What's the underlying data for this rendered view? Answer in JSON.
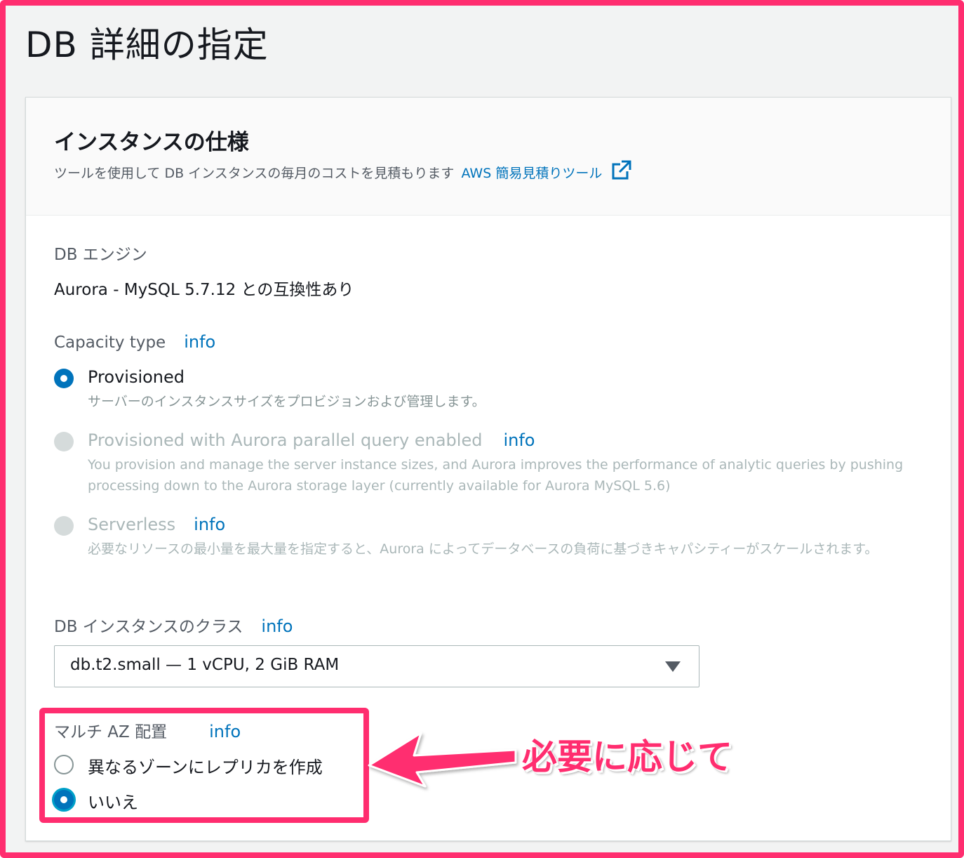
{
  "page": {
    "title": "DB 詳細の指定"
  },
  "panel": {
    "title": "インスタンスの仕様",
    "description": "ツールを使用して DB インスタンスの毎月のコストを見積もります",
    "description_link": "AWS 簡易見積りツール",
    "external_icon": "external-link-icon"
  },
  "engine": {
    "label": "DB エンジン",
    "value": "Aurora - MySQL 5.7.12 との互換性あり"
  },
  "capacity": {
    "label": "Capacity type",
    "info": "info",
    "options": [
      {
        "title": "Provisioned",
        "description": "サーバーのインスタンスサイズをプロビジョンおよび管理します。",
        "state": "selected"
      },
      {
        "title": "Provisioned with Aurora parallel query enabled",
        "info": "info",
        "description": "You provision and manage the server instance sizes, and Aurora improves the performance of analytic queries by pushing processing down to the Aurora storage layer (currently available for Aurora MySQL 5.6)",
        "state": "disabled"
      },
      {
        "title": "Serverless",
        "info": "info",
        "description": "必要なリソースの最小量を最大量を指定すると、Aurora によってデータベースの負荷に基づきキャパシティーがスケールされます。",
        "state": "disabled"
      }
    ]
  },
  "instance_class": {
    "label": "DB インスタンスのクラス",
    "info": "info",
    "selected": "db.t2.small — 1 vCPU, 2 GiB RAM"
  },
  "multi_az": {
    "label": "マルチ AZ 配置",
    "info": "info",
    "options": [
      {
        "title": "異なるゾーンにレプリカを作成",
        "state": "unselected"
      },
      {
        "title": "いいえ",
        "state": "selected"
      }
    ]
  },
  "annotation": {
    "text": "必要に応じて"
  },
  "colors": {
    "accent": "#0073bb",
    "highlight": "#ff2d6f"
  }
}
